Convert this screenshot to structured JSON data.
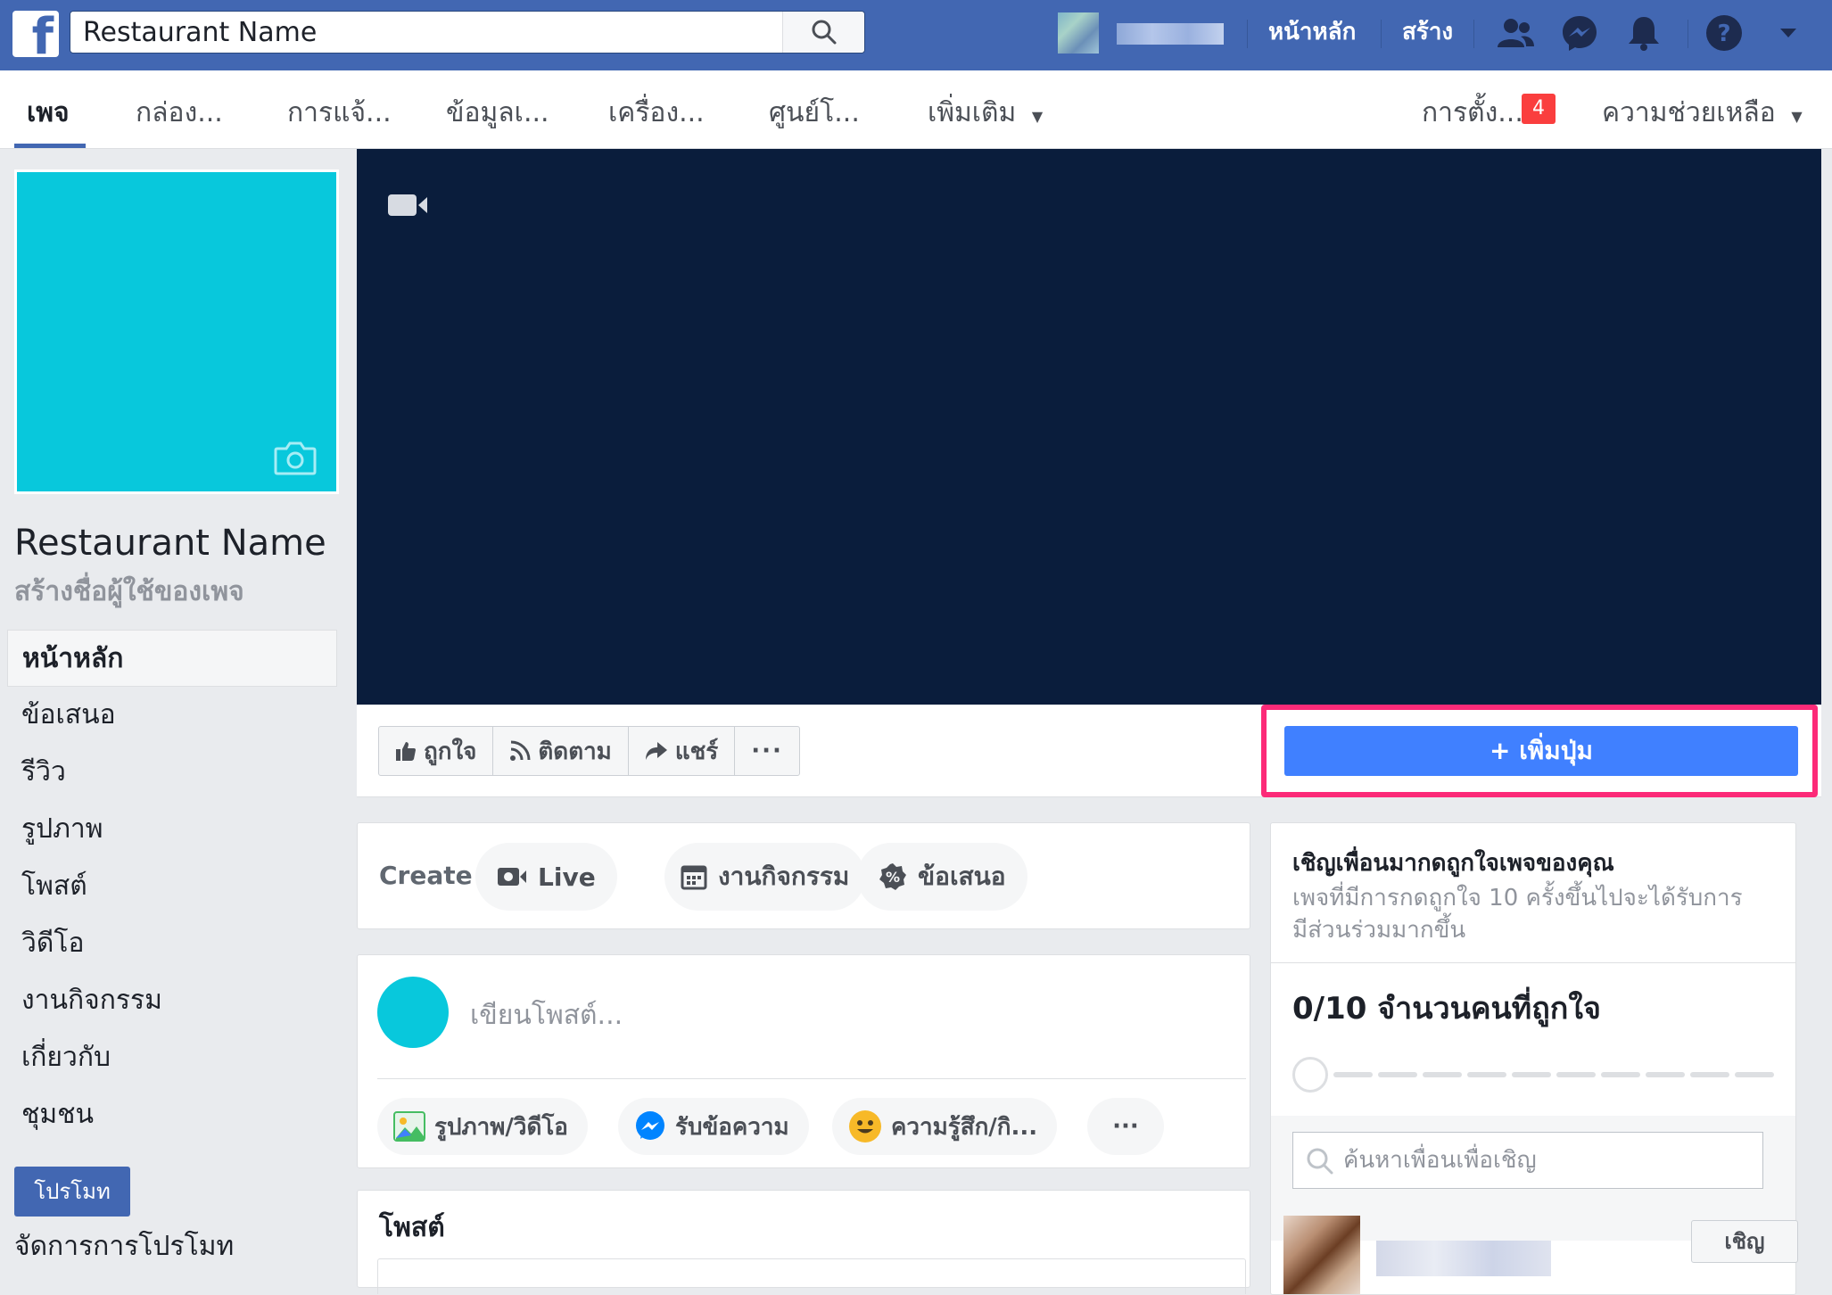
{
  "topbar": {
    "search_value": "Restaurant Name",
    "home_link": "หน้าหลัก",
    "create_link": "สร้าง"
  },
  "tabs": [
    {
      "label": "เพจ",
      "active": true
    },
    {
      "label": "กล่อง..."
    },
    {
      "label": "การแจ้..."
    },
    {
      "label": "ข้อมูลเ..."
    },
    {
      "label": "เครื่อง..."
    },
    {
      "label": "ศูนย์โ..."
    },
    {
      "label": "เพิ่มเติม"
    }
  ],
  "tabs_right": {
    "settings_label": "การตั้ง...",
    "settings_badge": "4",
    "help_label": "ความช่วยเหลือ"
  },
  "profile": {
    "name": "Restaurant Name",
    "username_prompt": "สร้างชื่อผู้ใช้ของเพจ"
  },
  "side_nav": [
    {
      "label": "หน้าหลัก",
      "active": true
    },
    {
      "label": "ข้อเสนอ"
    },
    {
      "label": "รีวิว"
    },
    {
      "label": "รูปภาพ"
    },
    {
      "label": "โพสต์"
    },
    {
      "label": "วิดีโอ"
    },
    {
      "label": "งานกิจกรรม"
    },
    {
      "label": "เกี่ยวกับ"
    },
    {
      "label": "ชุมชน"
    }
  ],
  "promote": {
    "button_label": "โปรโมท",
    "manage_label": "จัดการการโปรโมท"
  },
  "actions": {
    "like": "ถูกใจ",
    "follow": "ติดตาม",
    "share": "แชร์",
    "more": "···",
    "add_button": "+ เพิ่มปุ่ม"
  },
  "create": {
    "label": "Create",
    "live": "Live",
    "event": "งานกิจกรรม",
    "offer": "ข้อเสนอ"
  },
  "composer": {
    "placeholder": "เขียนโพสต์...",
    "photo_video": "รูปภาพ/วิดีโอ",
    "messages": "รับข้อความ",
    "feeling": "ความรู้สึก/กิ...",
    "more": "···"
  },
  "posts": {
    "title": "โพสต์"
  },
  "invite": {
    "title": "เชิญเพื่อนมากดถูกใจเพจของคุณ",
    "description": "เพจที่มีการกดถูกใจ 10 ครั้งขึ้นไปจะได้รับการมีส่วนร่วมมากขึ้น",
    "progress_text": "0/10 จำนวนคนที่ถูกใจ",
    "likes_current": 0,
    "likes_goal": 10,
    "search_placeholder": "ค้นหาเพื่อนเพื่อเชิญ",
    "invite_button": "เชิญ"
  },
  "colors": {
    "topbar": "#4267b2",
    "profile_cyan": "#08c8dc",
    "cover_navy": "#0a1d3c",
    "add_button": "#4080ff",
    "highlight": "#fc2a78",
    "badge_red": "#fa3e3e"
  }
}
